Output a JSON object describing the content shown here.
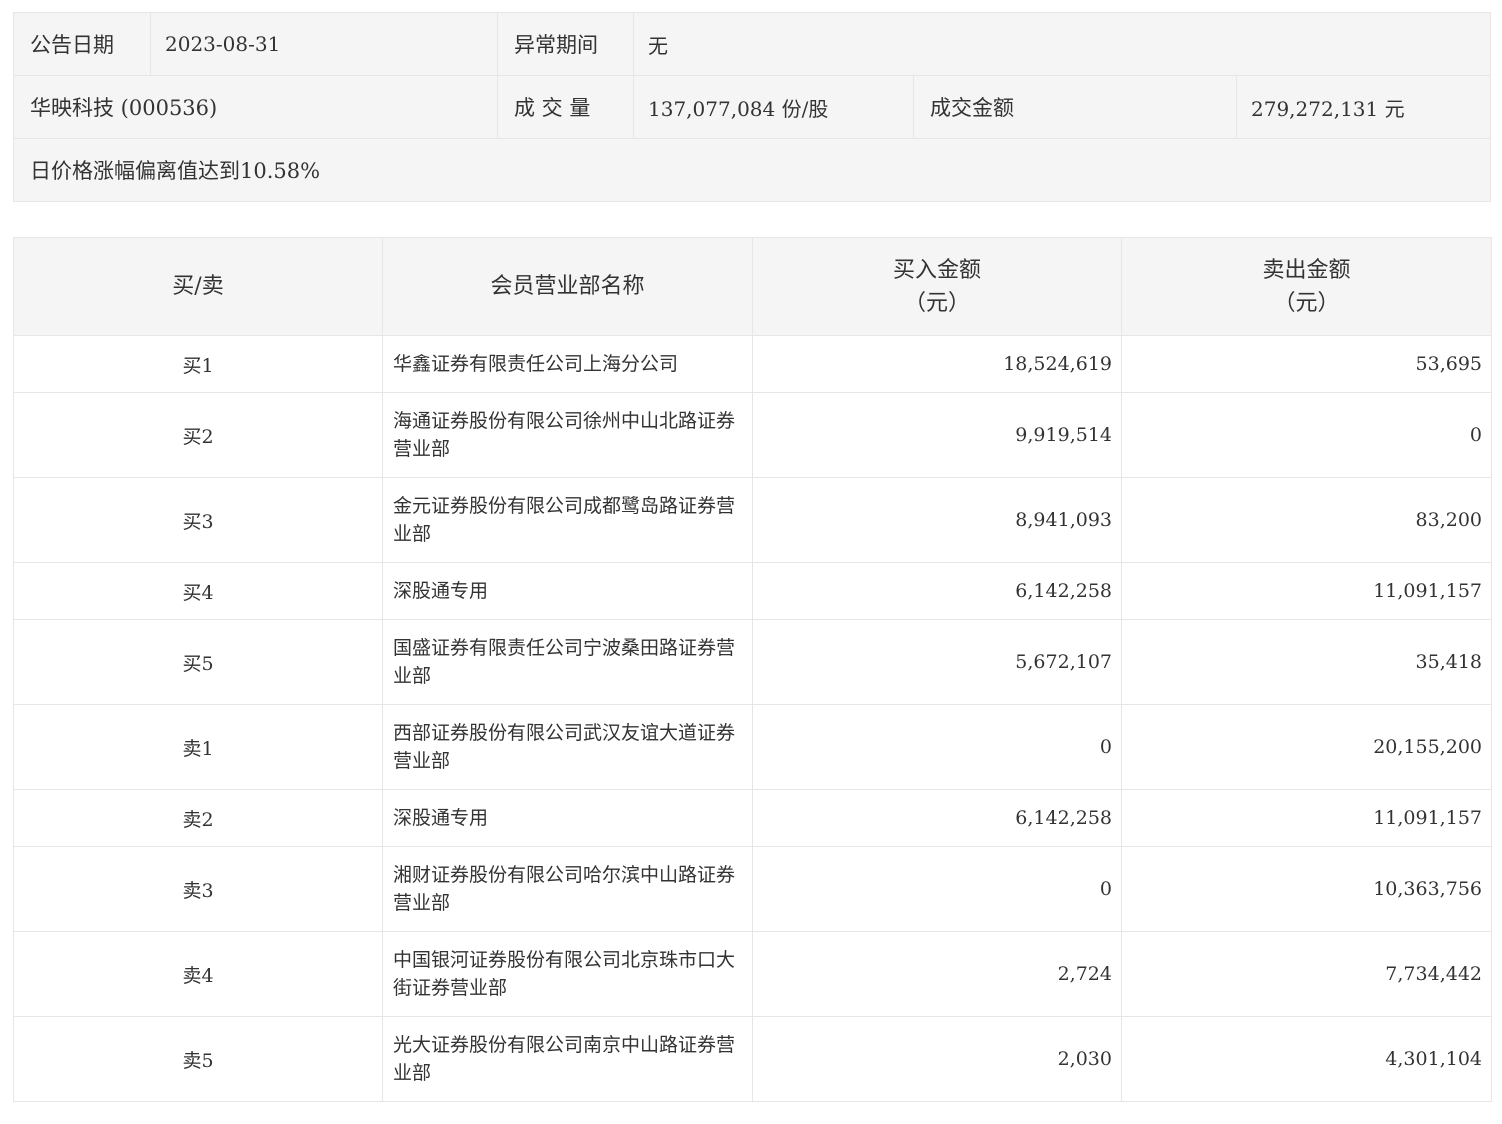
{
  "summary": {
    "announce_date_label": "公告日期",
    "announce_date_value": "2023-08-31",
    "abnormal_period_label": "异常期间",
    "abnormal_period_value": "无",
    "stock_name": "华映科技 (000536)",
    "volume_label": "成 交 量",
    "volume_value": "137,077,084 份/股",
    "turnover_label": "成交金额",
    "turnover_value": "279,272,131 元",
    "reason": "日价格涨幅偏离值达到10.58%"
  },
  "table": {
    "headers": {
      "side": "买/卖",
      "branch": "会员营业部名称",
      "buy_amount": "买入金额",
      "buy_unit": "（元）",
      "sell_amount": "卖出金额",
      "sell_unit": "（元）"
    },
    "rows": [
      {
        "side": "买1",
        "branch": "华鑫证券有限责任公司上海分公司",
        "buy": "18,524,619",
        "sell": "53,695"
      },
      {
        "side": "买2",
        "branch": "海通证券股份有限公司徐州中山北路证券营业部",
        "buy": "9,919,514",
        "sell": "0"
      },
      {
        "side": "买3",
        "branch": "金元证券股份有限公司成都鹭岛路证券营业部",
        "buy": "8,941,093",
        "sell": "83,200"
      },
      {
        "side": "买4",
        "branch": "深股通专用",
        "buy": "6,142,258",
        "sell": "11,091,157"
      },
      {
        "side": "买5",
        "branch": "国盛证券有限责任公司宁波桑田路证券营业部",
        "buy": "5,672,107",
        "sell": "35,418"
      },
      {
        "side": "卖1",
        "branch": "西部证券股份有限公司武汉友谊大道证券营业部",
        "buy": "0",
        "sell": "20,155,200"
      },
      {
        "side": "卖2",
        "branch": "深股通专用",
        "buy": "6,142,258",
        "sell": "11,091,157"
      },
      {
        "side": "卖3",
        "branch": "湘财证券股份有限公司哈尔滨中山路证券营业部",
        "buy": "0",
        "sell": "10,363,756"
      },
      {
        "side": "卖4",
        "branch": "中国银河证券股份有限公司北京珠市口大街证券营业部",
        "buy": "2,724",
        "sell": "7,734,442"
      },
      {
        "side": "卖5",
        "branch": "光大证券股份有限公司南京中山路证券营业部",
        "buy": "2,030",
        "sell": "4,301,104"
      }
    ]
  }
}
